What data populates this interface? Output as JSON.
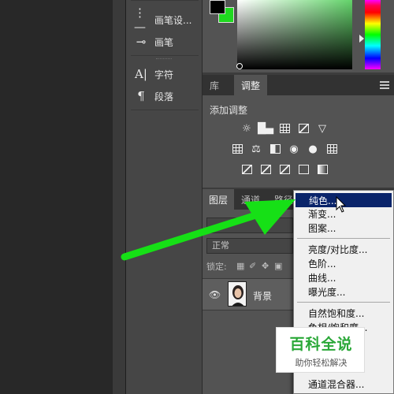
{
  "mid_panel": {
    "items": [
      {
        "label": "画笔设...",
        "icon": "brush-settings-icon"
      },
      {
        "label": "画笔",
        "icon": "brush-icon"
      },
      {
        "label": "字符",
        "icon": "character-icon"
      },
      {
        "label": "段落",
        "icon": "paragraph-icon"
      }
    ]
  },
  "color": {
    "foreground": "#000000",
    "background": "#1fd81f"
  },
  "adjust_tabs": [
    {
      "label": "库",
      "active": false
    },
    {
      "label": "调整",
      "active": true
    }
  ],
  "adjust": {
    "title": "添加调整",
    "icons": [
      "brightness-icon",
      "levels-icon",
      "curves-icon",
      "exposure-icon",
      "vibrance-icon",
      "hue-saturation-icon",
      "color-balance-icon",
      "black-white-icon",
      "photo-filter-icon",
      "channel-mixer-icon",
      "color-lookup-icon",
      "invert-icon",
      "posterize-icon",
      "threshold-icon",
      "selective-color-icon",
      "gradient-map-icon"
    ]
  },
  "layer_tabs": [
    {
      "label": "图层",
      "active": true
    },
    {
      "label": "通道",
      "active": false
    },
    {
      "label": "路径",
      "active": false
    }
  ],
  "layers": {
    "blend_mode": "正常",
    "lock_label": "锁定:",
    "rows": [
      {
        "name": "背景",
        "visible": true
      }
    ]
  },
  "context_menu": {
    "groups": [
      [
        "纯色...",
        "渐变...",
        "图案..."
      ],
      [
        "亮度/对比度...",
        "色阶...",
        "曲线...",
        "曝光度..."
      ],
      [
        "自然饱和度...",
        "色相/饱和度..."
      ],
      [
        "通道混合器..."
      ]
    ],
    "highlighted": "纯色..."
  },
  "watermark": {
    "title": "百科全说",
    "subtitle": "助你轻松解决"
  }
}
